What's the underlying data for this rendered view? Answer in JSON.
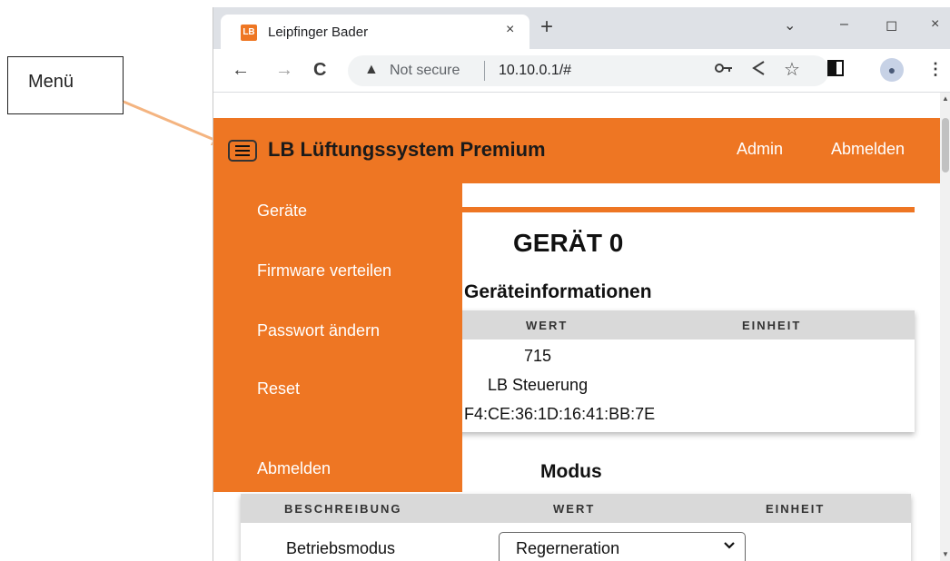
{
  "annotation": {
    "callout_label": "Menü"
  },
  "browser": {
    "tab_title": "Leipfinger Bader",
    "favicon_text": "LB",
    "tab_close": "×",
    "new_tab": "+",
    "win_dropdown": "⌄",
    "win_minimize": "–",
    "win_maximize": "◻",
    "win_close": "×",
    "back": "←",
    "forward": "→",
    "reload": "C",
    "warning_icon": "▲",
    "not_secure": "Not secure",
    "url": "10.10.0.1/#",
    "icons": [
      "key-icon",
      "share-icon",
      "star-icon",
      "sidepanel-icon",
      "profile-icon",
      "more-icon"
    ]
  },
  "header": {
    "title": "LB Lüftungssystem Premium",
    "admin_link": "Admin",
    "logout_link": "Abmelden"
  },
  "sidebar": {
    "items": [
      {
        "label": "Geräte"
      },
      {
        "label": "Firmware verteilen"
      },
      {
        "label": "Passwort ändern"
      },
      {
        "label": "Reset"
      },
      {
        "label": "Abmelden"
      }
    ]
  },
  "main": {
    "page_title": "GERÄT 0",
    "info_heading": "Geräteinformationen",
    "info_table": {
      "headers": [
        "WERT",
        "EINHEIT"
      ],
      "rows": [
        {
          "wert": "715",
          "einheit": ""
        },
        {
          "wert": "LB Steuerung",
          "einheit": ""
        },
        {
          "wert": "F4:CE:36:1D:16:41:BB:7E",
          "einheit": ""
        }
      ]
    },
    "modus_heading": "Modus",
    "modus_table": {
      "headers": [
        "BESCHREIBUNG",
        "WERT",
        "EINHEIT"
      ],
      "rows": [
        {
          "beschreibung": "Betriebsmodus",
          "wert": "Regerneration",
          "einheit": ""
        }
      ]
    }
  },
  "colors": {
    "accent": "#ee7623",
    "header_text": "#ffffff",
    "table_header_bg": "#d9d9d9"
  }
}
